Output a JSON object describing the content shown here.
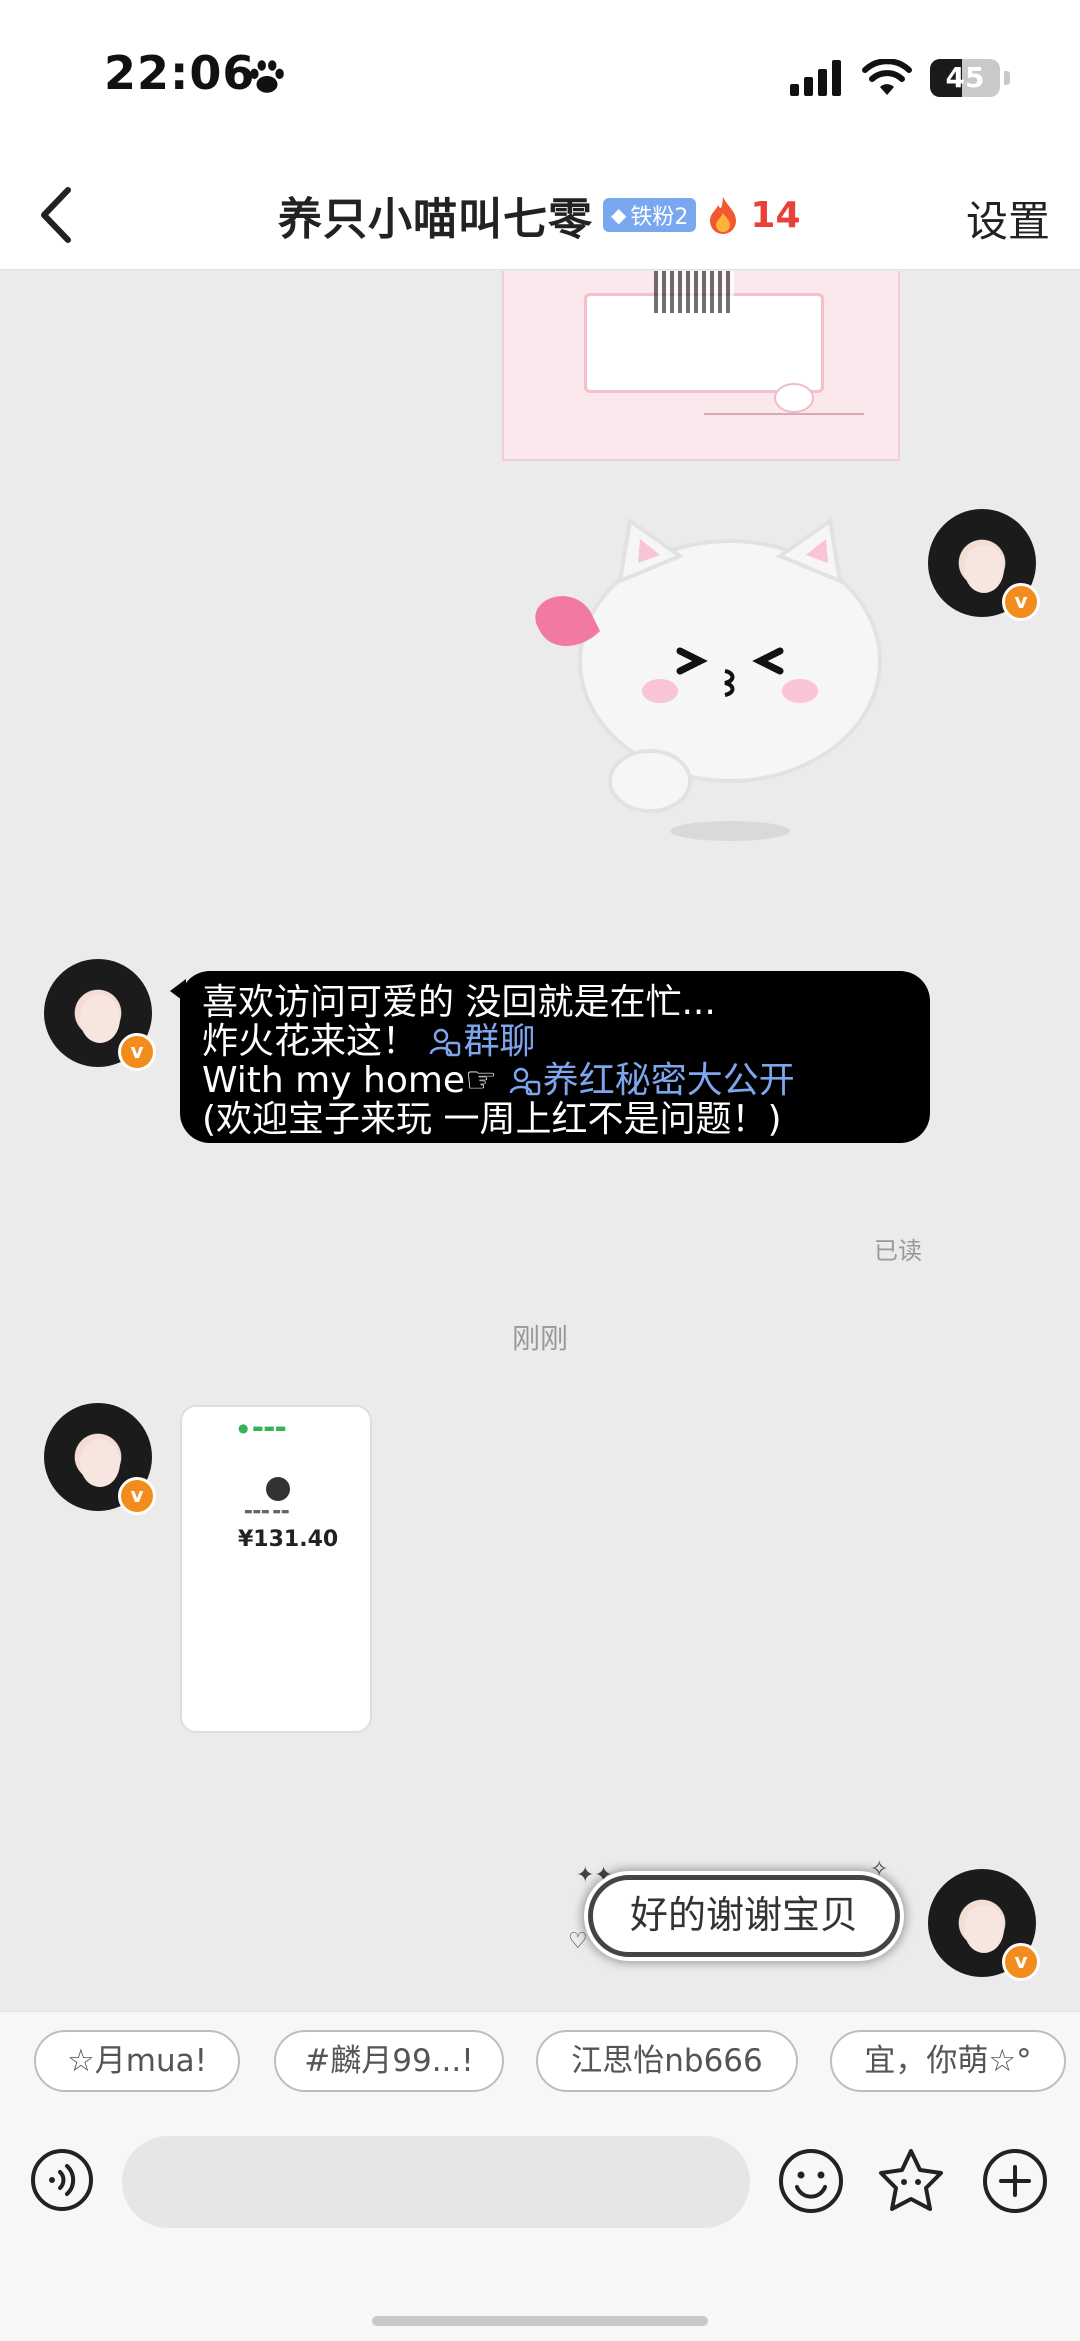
{
  "status_bar": {
    "time": "22:06",
    "battery": "45",
    "battery_level": 0.45
  },
  "nav": {
    "back_icon": "chevron-left-icon",
    "title": "养只小喵叫七零",
    "fan_badge": "铁粉2",
    "streak_icon": "fire-icon",
    "streak_count": "14",
    "settings": "设置"
  },
  "messages": {
    "welcome_lines": [
      "喜欢访问可爱的 没回就是在忙...",
      "炸火花来这！",
      "With my home☞",
      "(欢迎宝子来玩 一周上红不是问题！)"
    ],
    "group_link_1": "群聊",
    "group_link_2": "养红秘密大公开",
    "read_status": "已读",
    "timestamp": "刚刚",
    "payment_amount": "¥131.40",
    "reply_text": "好的谢谢宝贝"
  },
  "quick_replies": [
    "☆月mua!",
    "#麟月99...!",
    "江思怡nb666",
    "宜，你萌☆°"
  ],
  "input": {
    "placeholder": "",
    "icons": [
      "voice-icon",
      "emoji-icon",
      "sticker-icon",
      "plus-icon"
    ]
  },
  "colors": {
    "link": "#7ea6ee",
    "streak": "#e9403a",
    "verified": "#f28c1d",
    "badge": "#7aa8f0"
  }
}
